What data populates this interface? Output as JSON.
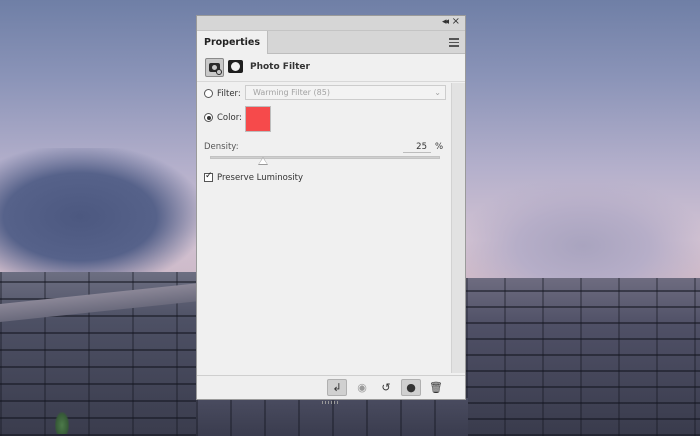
{
  "panel": {
    "tab_label": "Properties",
    "header_title": "Photo Filter"
  },
  "filter": {
    "label": "Filter:",
    "selected": "Warming Filter (85)"
  },
  "color": {
    "label": "Color:",
    "swatch": "#f64a4b"
  },
  "density": {
    "label": "Density:",
    "value": "25",
    "unit": "%",
    "level": 0.25
  },
  "preserve_luminosity": {
    "label": "Preserve Luminosity",
    "checked": true
  },
  "icons": {
    "collapse": "◂◂",
    "close": "×",
    "clip": "↲",
    "view_previous": "◉",
    "reset": "↺",
    "visibility": "●",
    "trash": "🗑"
  }
}
